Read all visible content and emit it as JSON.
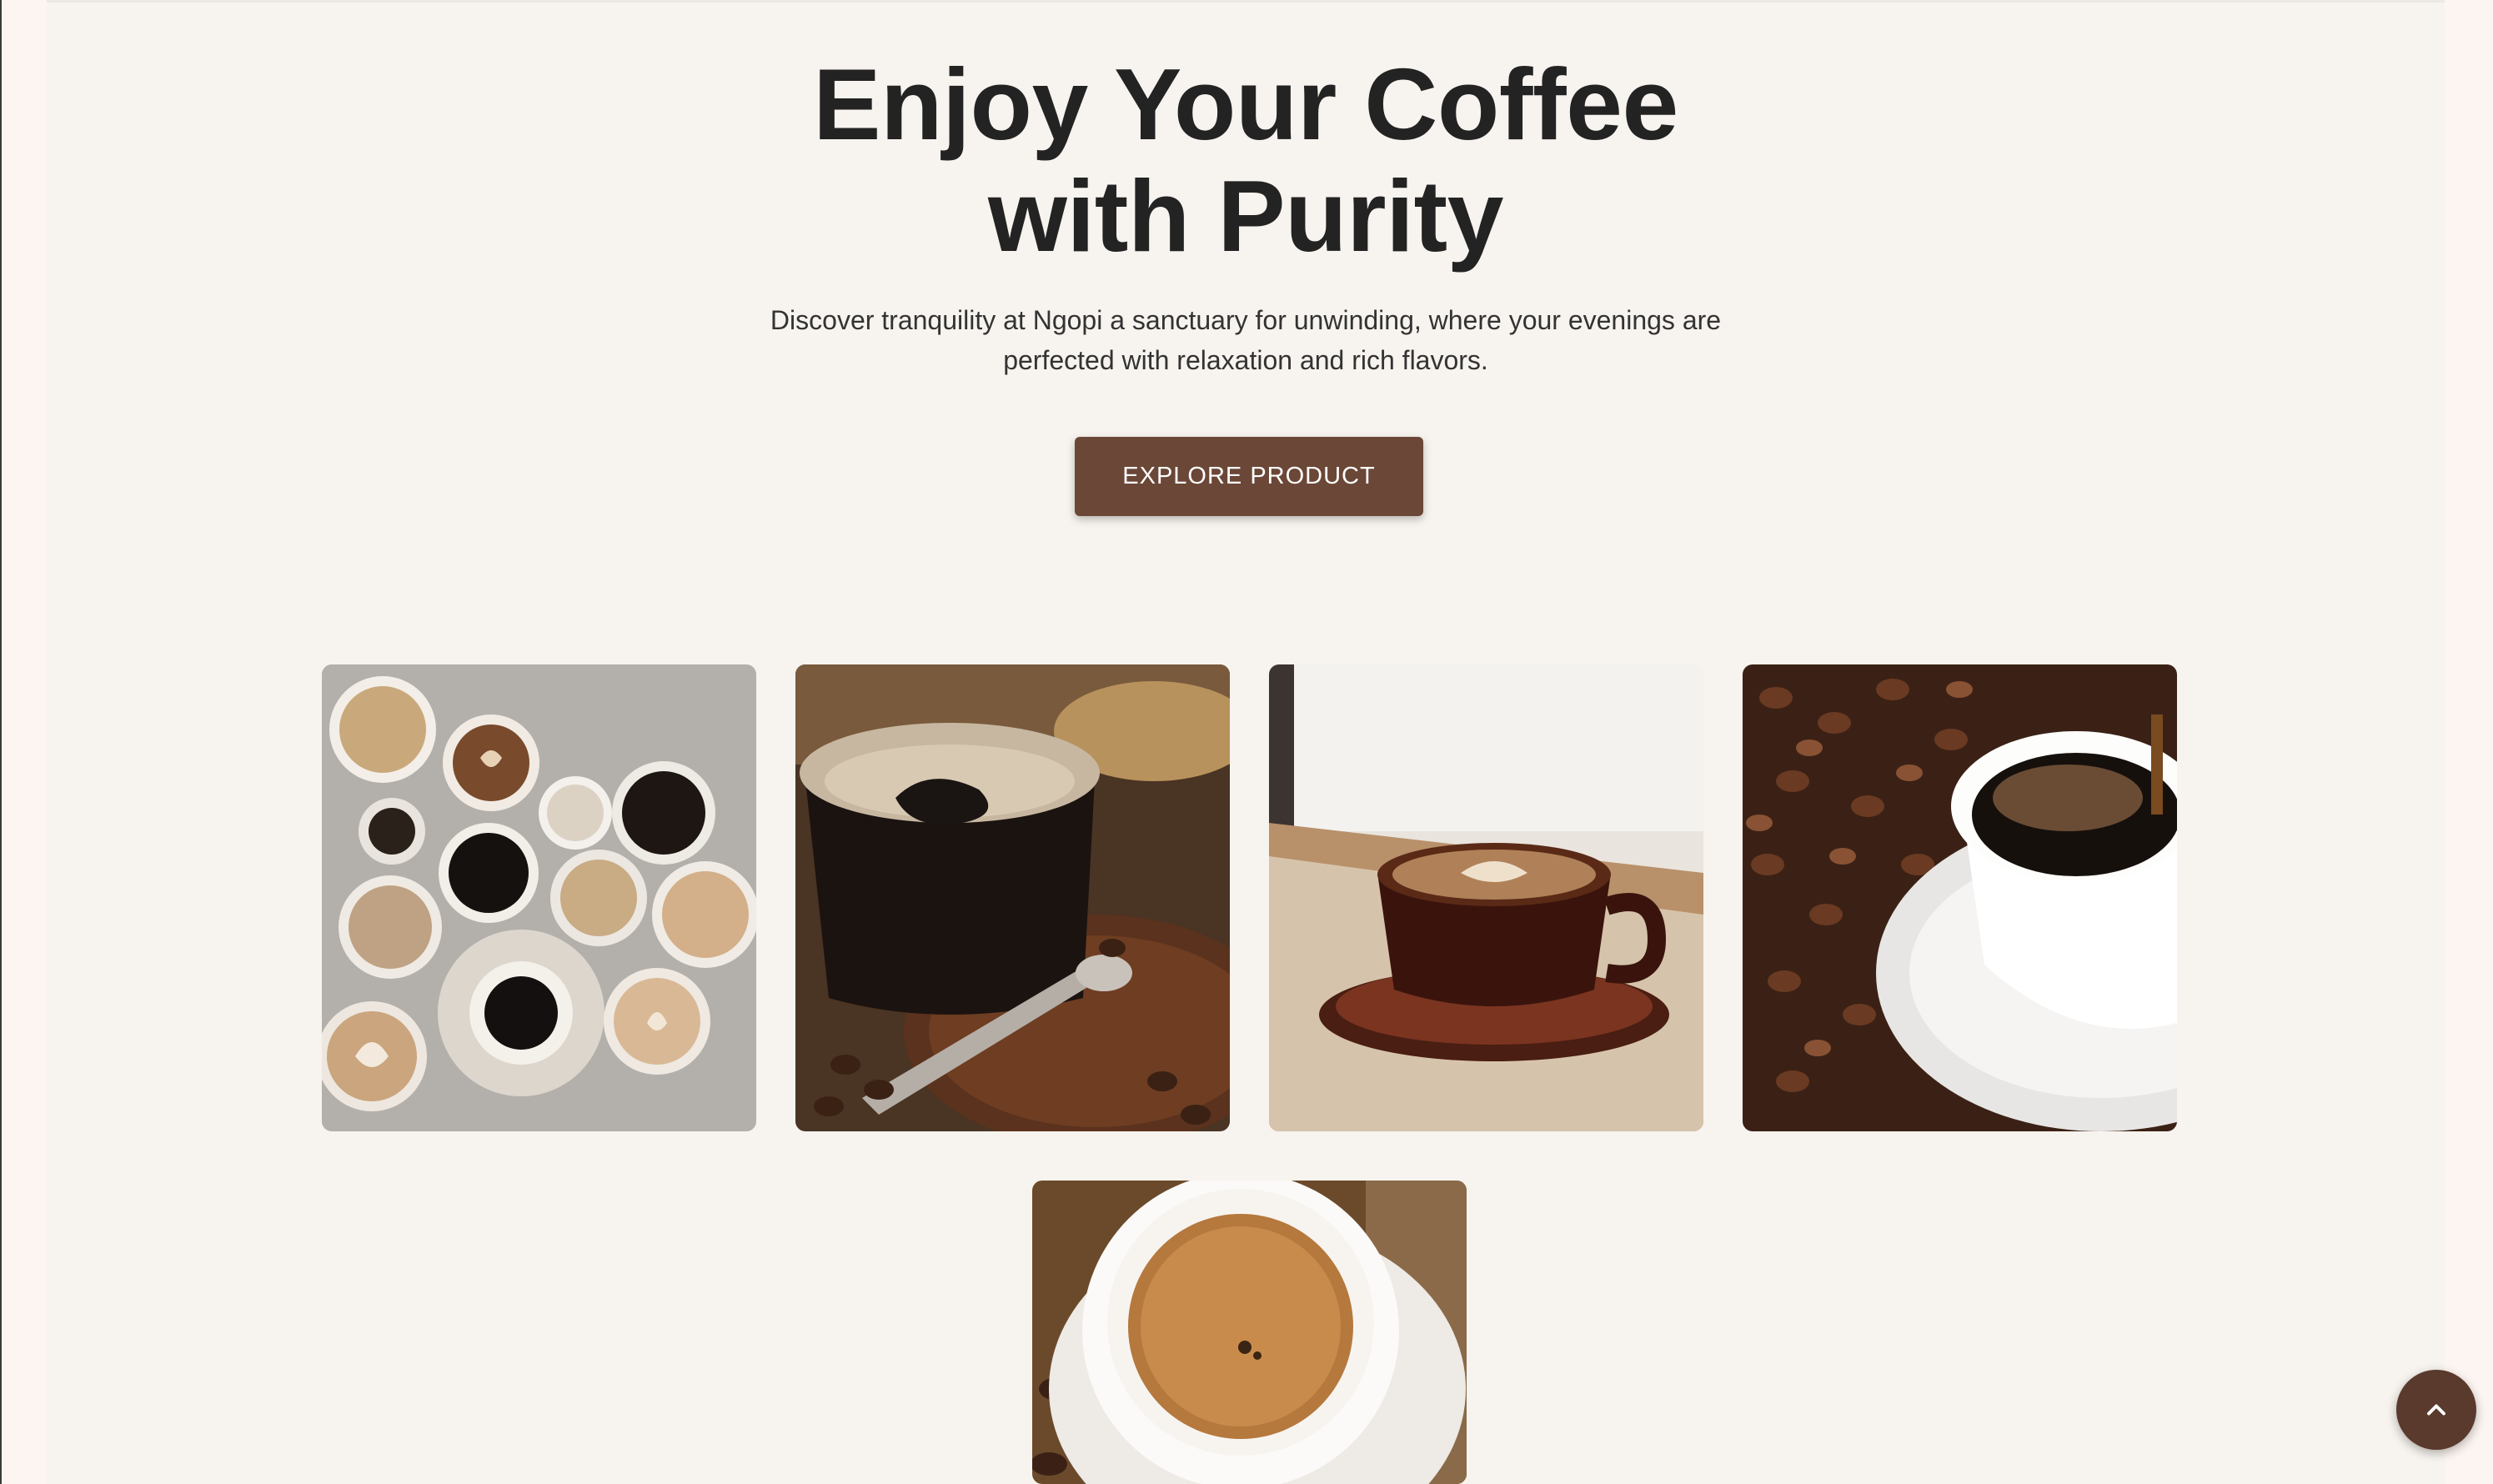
{
  "hero": {
    "title_line1": "Enjoy Your Coffee",
    "title_line2": "with Purity",
    "subtitle": "Discover tranquility at Ngopi a sanctuary for unwinding, where your evenings are perfected with relaxation and rich flavors.",
    "cta_label": "EXPLORE PRODUCT"
  },
  "gallery": {
    "images": [
      {
        "alt": "assorted coffee cups top view"
      },
      {
        "alt": "black coffee in glass cup with spoon"
      },
      {
        "alt": "cappuccino with latte art on saucer"
      },
      {
        "alt": "coffee pouring into white cup on beans"
      },
      {
        "alt": "espresso crema in white cup"
      }
    ]
  },
  "scroll_top": {
    "icon": "chevron-up-icon"
  },
  "colors": {
    "accent": "#6b4737",
    "background": "#f7f3ee",
    "heading": "#232323"
  }
}
